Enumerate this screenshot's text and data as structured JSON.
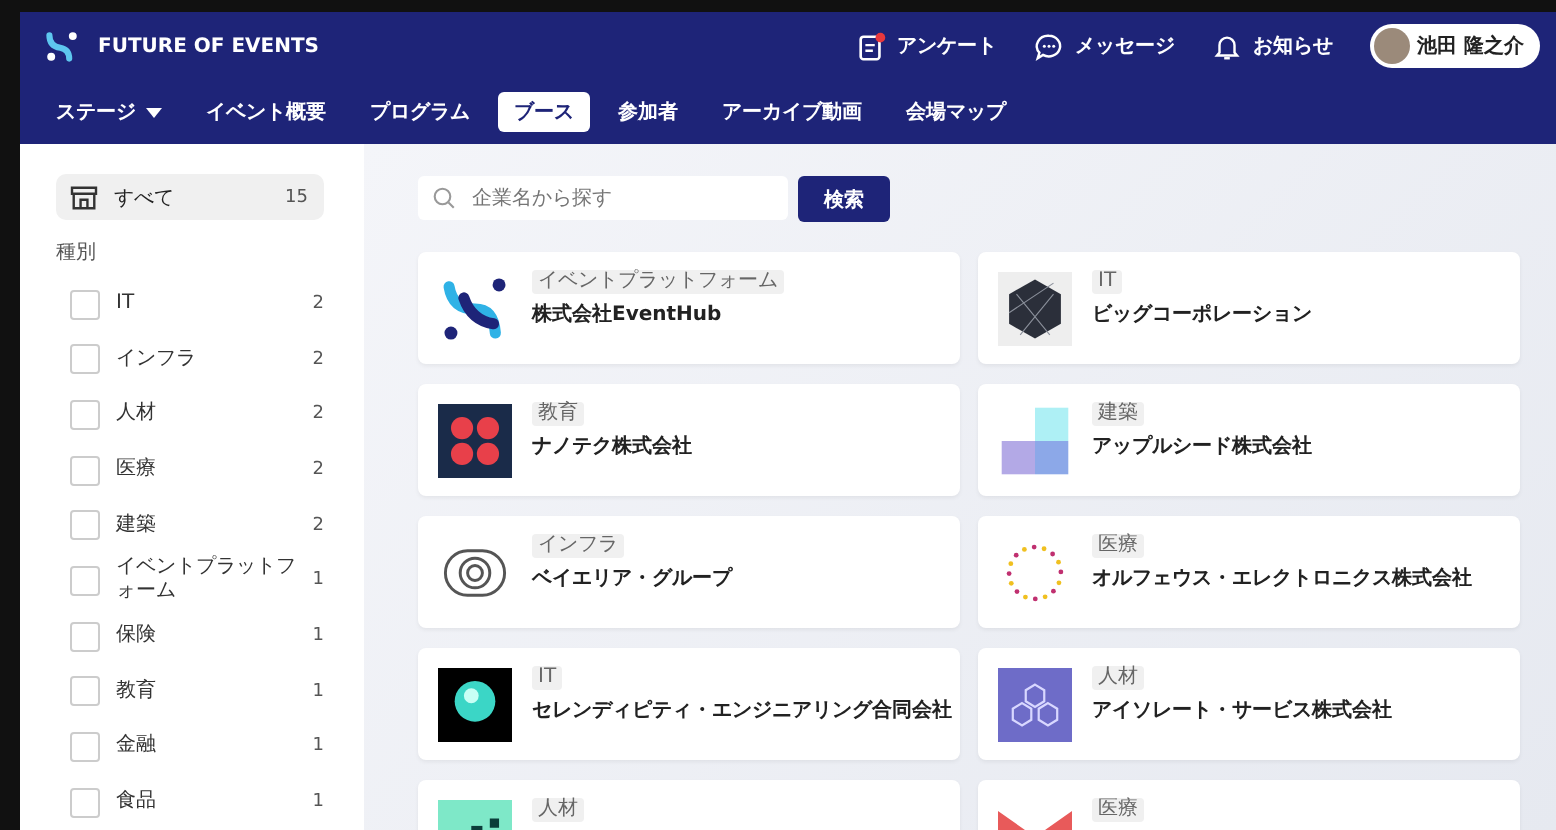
{
  "header": {
    "brand": "FUTURE OF EVENTS",
    "actions": [
      {
        "kind": "survey",
        "label": "アンケート",
        "has_notification": true
      },
      {
        "kind": "message",
        "label": "メッセージ",
        "has_notification": false
      },
      {
        "kind": "bell",
        "label": "お知らせ",
        "has_notification": false
      }
    ],
    "user": {
      "name": "池田 隆之介"
    }
  },
  "nav": [
    {
      "label": "ステージ",
      "dropdown": true,
      "selected": false
    },
    {
      "label": "イベント概要",
      "dropdown": false,
      "selected": false
    },
    {
      "label": "プログラム",
      "dropdown": false,
      "selected": false
    },
    {
      "label": "ブース",
      "dropdown": false,
      "selected": true
    },
    {
      "label": "参加者",
      "dropdown": false,
      "selected": false
    },
    {
      "label": "アーカイブ動画",
      "dropdown": false,
      "selected": false
    },
    {
      "label": "会場マップ",
      "dropdown": false,
      "selected": false
    }
  ],
  "sidebar": {
    "all": {
      "label": "すべて",
      "count": "15",
      "selected": true
    },
    "heading": "種別",
    "filters": [
      {
        "label": "IT",
        "count": "2",
        "checked": false
      },
      {
        "label": "インフラ",
        "count": "2",
        "checked": false
      },
      {
        "label": "人材",
        "count": "2",
        "checked": false
      },
      {
        "label": "医療",
        "count": "2",
        "checked": false
      },
      {
        "label": "建築",
        "count": "2",
        "checked": false
      },
      {
        "label": "イベントプラットフォーム",
        "count": "1",
        "checked": false
      },
      {
        "label": "保険",
        "count": "1",
        "checked": false
      },
      {
        "label": "教育",
        "count": "1",
        "checked": false
      },
      {
        "label": "金融",
        "count": "1",
        "checked": false
      },
      {
        "label": "食品",
        "count": "1",
        "checked": false
      }
    ]
  },
  "search": {
    "placeholder": "企業名から探す",
    "button": "検索"
  },
  "booths": [
    {
      "tag": "イベントプラットフォーム",
      "name": "株式会社EventHub"
    },
    {
      "tag": "IT",
      "name": "ビッグコーポレーション"
    },
    {
      "tag": "教育",
      "name": "ナノテク株式会社"
    },
    {
      "tag": "建築",
      "name": "アップルシード株式会社"
    },
    {
      "tag": "インフラ",
      "name": "ベイエリア・グループ"
    },
    {
      "tag": "医療",
      "name": "オルフェウス・エレクトロニクス株式会社"
    },
    {
      "tag": "IT",
      "name": "セレンディピティ・エンジニアリング合同会社"
    },
    {
      "tag": "人材",
      "name": "アイソレート・サービス株式会社"
    },
    {
      "tag": "人材"
    },
    {
      "tag": "医療"
    }
  ]
}
